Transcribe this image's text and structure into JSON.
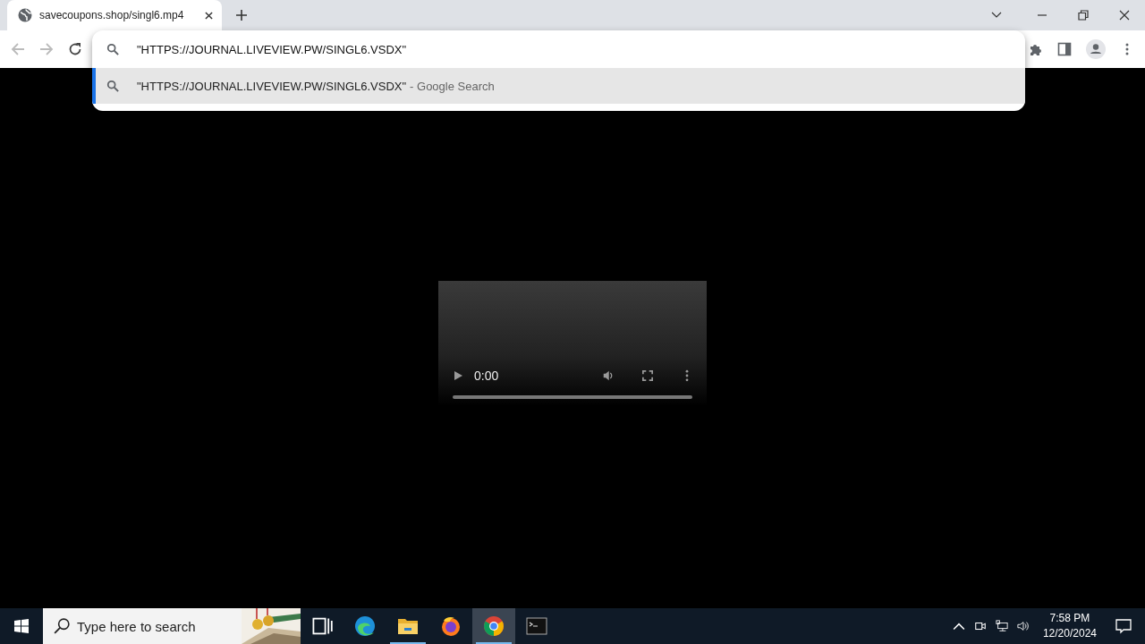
{
  "tab": {
    "title": "savecoupons.shop/singl6.mp4"
  },
  "omnibox": {
    "value": "\"HTTPS://JOURNAL.LIVEVIEW.PW/SINGL6.VSDX\"",
    "suggestions": [
      {
        "text": "\"HTTPS://JOURNAL.LIVEVIEW.PW/SINGL6.VSDX\"",
        "source": "- Google Search",
        "selected": true
      }
    ]
  },
  "video": {
    "time": "0:00"
  },
  "taskbar": {
    "search": {
      "placeholder": "Type here to search"
    },
    "apps": [
      {
        "kind": "task-view",
        "running": false,
        "selected": false
      },
      {
        "kind": "edge",
        "running": false,
        "selected": false
      },
      {
        "kind": "explorer",
        "running": true,
        "selected": false
      },
      {
        "kind": "firefox",
        "running": false,
        "selected": false
      },
      {
        "kind": "chrome",
        "running": true,
        "selected": true
      },
      {
        "kind": "terminal",
        "running": false,
        "selected": false
      }
    ],
    "clock": {
      "time": "7:58 PM",
      "date": "12/20/2024"
    }
  }
}
